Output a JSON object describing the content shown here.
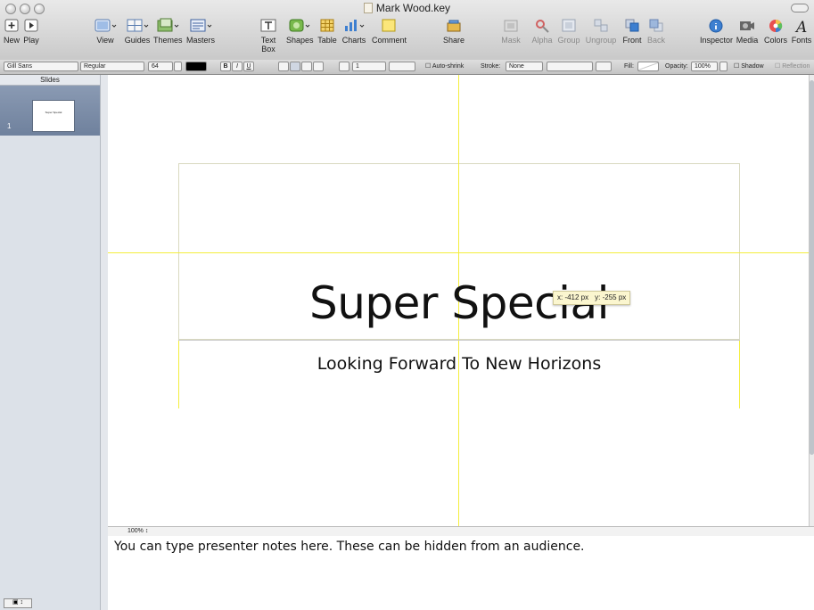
{
  "window": {
    "title": "Mark Wood.key"
  },
  "toolbar": {
    "items": [
      {
        "label": "New"
      },
      {
        "label": "Play"
      },
      {
        "label": "View"
      },
      {
        "label": "Guides"
      },
      {
        "label": "Themes"
      },
      {
        "label": "Masters"
      },
      {
        "label": "Text Box"
      },
      {
        "label": "Shapes"
      },
      {
        "label": "Table"
      },
      {
        "label": "Charts"
      },
      {
        "label": "Comment"
      },
      {
        "label": "Share"
      },
      {
        "label": "Mask"
      },
      {
        "label": "Alpha"
      },
      {
        "label": "Group"
      },
      {
        "label": "Ungroup"
      },
      {
        "label": "Front"
      },
      {
        "label": "Back"
      },
      {
        "label": "Inspector"
      },
      {
        "label": "Media"
      },
      {
        "label": "Colors"
      },
      {
        "label": "Fonts"
      }
    ]
  },
  "format_bar": {
    "font_family": "Gill Sans",
    "font_style": "Regular",
    "font_size": "64",
    "bold": "B",
    "italic": "I",
    "underline": "U",
    "line_spacing": "1",
    "auto_shrink": "Auto-shrink",
    "stroke_label": "Stroke:",
    "stroke_value": "None",
    "fill_label": "Fill:",
    "opacity_label": "Opacity:",
    "opacity_value": "100%",
    "shadow": "Shadow",
    "reflection": "Reflection"
  },
  "slides_panel": {
    "header": "Slides",
    "slides": [
      {
        "number": "1",
        "thumb_text": "Super Special"
      }
    ]
  },
  "slide": {
    "title": "Super Special",
    "subtitle": "Looking Forward To New Horizons",
    "coord_tooltip": {
      "x": "x: -412 px",
      "y": "y: -255 px"
    }
  },
  "zoom": {
    "value": "100%"
  },
  "notes": {
    "text": "You can type presenter notes here. These can be hidden from an audience."
  },
  "colors": {
    "guide": "#f4ee3c",
    "selection": "#7a8ba6"
  }
}
